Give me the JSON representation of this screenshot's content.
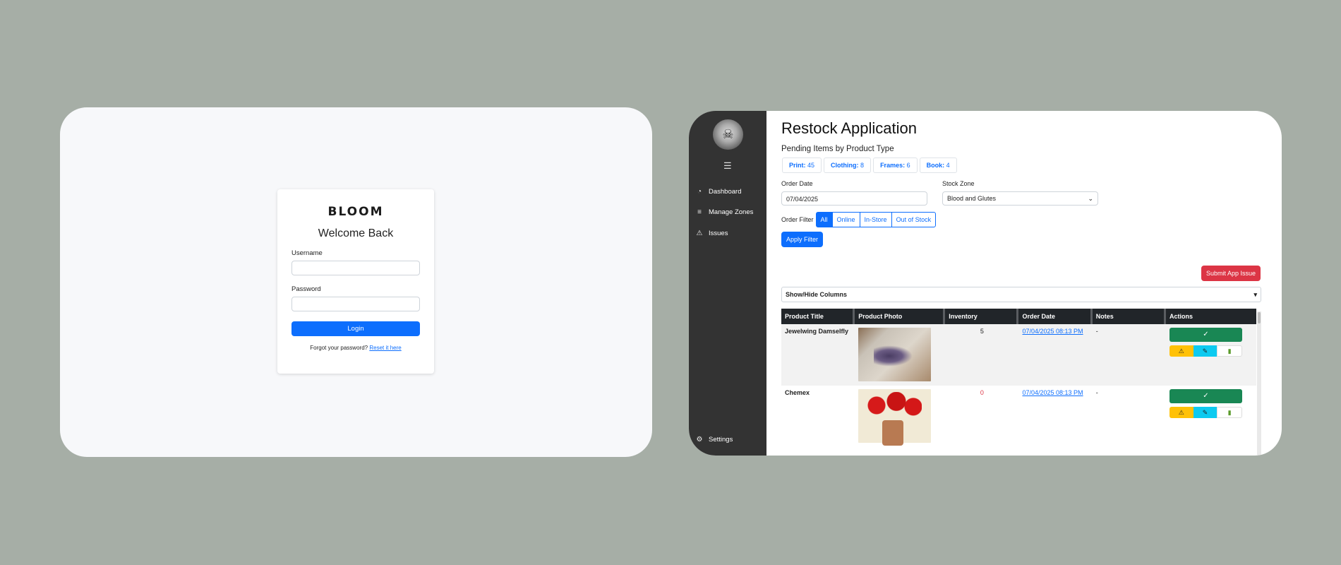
{
  "login": {
    "logo": "BLOOM",
    "heading": "Welcome Back",
    "username_label": "Username",
    "username_value": "",
    "password_label": "Password",
    "password_value": "",
    "login_button": "Login",
    "forgot_text": "Forgot your password?",
    "reset_link": "Reset it here"
  },
  "sidebar": {
    "menu_icon": "☰",
    "items": [
      {
        "label": "Dashboard",
        "icon": "gauge-icon"
      },
      {
        "label": "Manage Zones",
        "icon": "sliders-icon"
      },
      {
        "label": "Issues",
        "icon": "warning-icon"
      }
    ],
    "settings_label": "Settings"
  },
  "app": {
    "title": "Restock Application",
    "pending_title": "Pending Items by Product Type",
    "pending": [
      {
        "label": "Print:",
        "count": "45"
      },
      {
        "label": "Clothing:",
        "count": "8"
      },
      {
        "label": "Frames:",
        "count": "6"
      },
      {
        "label": "Book:",
        "count": "4"
      }
    ],
    "order_date_label": "Order Date",
    "order_date_value": "07/04/2025",
    "stock_zone_label": "Stock Zone",
    "stock_zone_value": "Blood and Glutes",
    "order_filter_label": "Order Filter",
    "order_filters": [
      "All",
      "Online",
      "In-Store",
      "Out of Stock"
    ],
    "active_filter": "All",
    "apply_button": "Apply Filter",
    "submit_issue_button": "Submit App Issue",
    "columns_toggle": "Show/Hide Columns",
    "columns_toggle_arrow": "▾",
    "table": {
      "headers": [
        "Product Title",
        "Product Photo",
        "Inventory",
        "Order Date",
        "Notes",
        "Actions"
      ],
      "rows": [
        {
          "title": "Jewelwing Damselfly",
          "inventory": "5",
          "order_date": "07/04/2025 08:13 PM",
          "notes": "-"
        },
        {
          "title": "Chemex",
          "inventory": "0",
          "order_date": "07/04/2025 08:13 PM",
          "notes": "-"
        }
      ]
    },
    "colors": {
      "primary": "#0d6efd",
      "danger": "#dc3545",
      "success": "#198754",
      "warning": "#ffc107",
      "info": "#0dcaf0",
      "sidebar": "#333333"
    }
  }
}
